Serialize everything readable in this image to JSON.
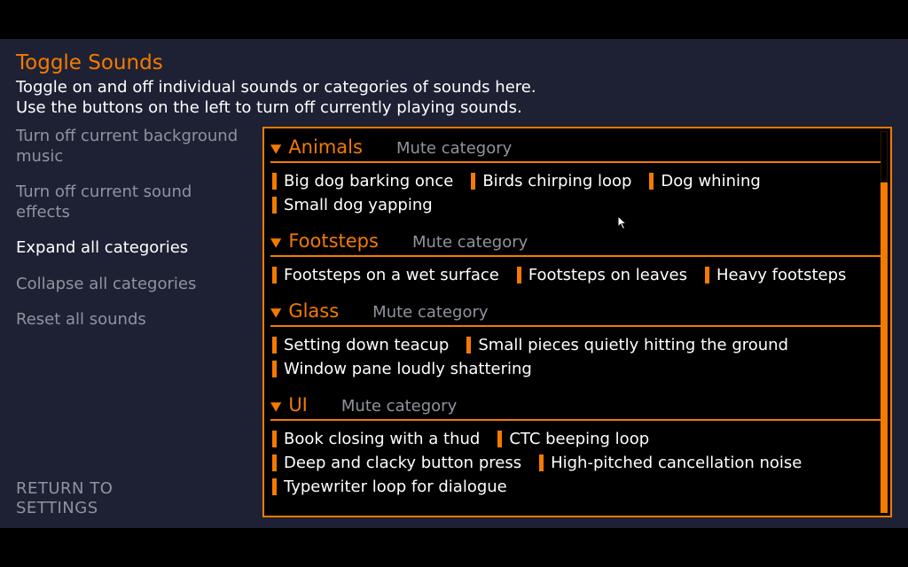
{
  "title": "Toggle Sounds",
  "subtitle_line1": "Toggle on and off individual sounds or categories of sounds here.",
  "subtitle_line2": "Use the buttons on the left to turn off currently playing sounds.",
  "sidebar": {
    "items": [
      {
        "label": "Turn off current background music",
        "active": false
      },
      {
        "label": "Turn off current sound effects",
        "active": false
      },
      {
        "label": "Expand all categories",
        "active": true
      },
      {
        "label": "Collapse all categories",
        "active": false
      },
      {
        "label": "Reset all sounds",
        "active": false
      }
    ],
    "return_label": "RETURN TO SETTINGS"
  },
  "mute_label": "Mute category",
  "categories": [
    {
      "name": "Animals",
      "sounds": [
        "Big dog barking once",
        "Birds chirping loop",
        "Dog whining",
        "Small dog yapping"
      ]
    },
    {
      "name": "Footsteps",
      "sounds": [
        "Footsteps on a wet surface",
        "Footsteps on leaves",
        "Heavy footsteps"
      ]
    },
    {
      "name": "Glass",
      "sounds": [
        "Setting down teacup",
        "Small pieces quietly hitting the ground",
        "Window pane loudly shattering"
      ]
    },
    {
      "name": "UI",
      "sounds": [
        "Book closing with a thud",
        "CTC beeping loop",
        "Deep and clacky button press",
        "High-pitched cancellation noise",
        "Typewriter loop for dialogue"
      ]
    }
  ]
}
